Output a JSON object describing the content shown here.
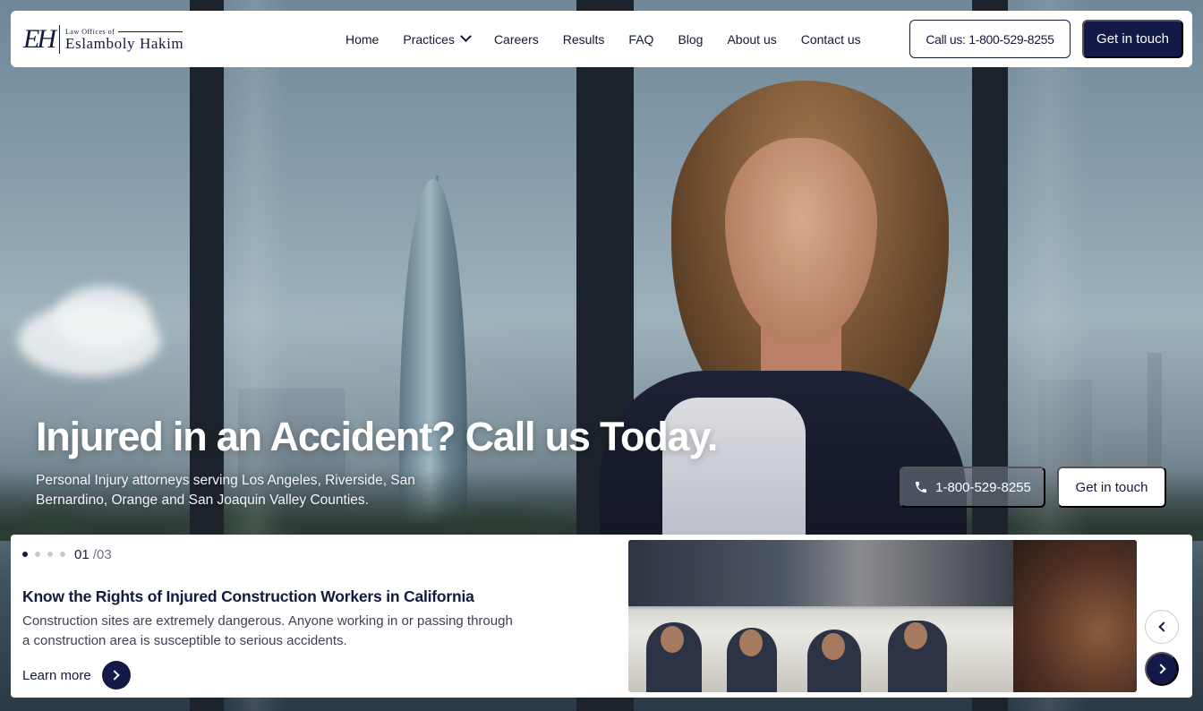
{
  "logo": {
    "monogram": "EH",
    "small_text": "Law Offices of",
    "name": "Eslamboly Hakim"
  },
  "nav": {
    "links": [
      {
        "label": "Home"
      },
      {
        "label": "Practices"
      },
      {
        "label": "Careers"
      },
      {
        "label": "Results"
      },
      {
        "label": "FAQ"
      },
      {
        "label": "Blog"
      },
      {
        "label": "About us"
      },
      {
        "label": "Contact us"
      }
    ],
    "call_label": "Call us: 1-800-529-8255",
    "touch_label": "Get in touch"
  },
  "hero": {
    "title": "Injured in an Accident? Call us Today.",
    "subtitle": "Personal Injury attorneys serving Los Angeles, Riverside, San Bernardino, Orange and San Joaquin Valley Counties.",
    "phone_label": "1-800-529-8255",
    "touch_label": "Get in touch"
  },
  "slider": {
    "current": "01",
    "total": "/03",
    "title": "Know the Rights of Injured Construction Workers in California",
    "description": "Construction sites are extremely dangerous. Anyone working in or passing through a construction area is susceptible to serious accidents.",
    "learn_more": "Learn more"
  },
  "icons": {
    "practices": "chevron-down-icon",
    "phone": "phone-icon",
    "learn": "arrow-right-icon",
    "prev": "chevron-left-icon",
    "next": "chevron-right-icon"
  },
  "colors": {
    "navy": "#131a48",
    "white": "#ffffff"
  }
}
